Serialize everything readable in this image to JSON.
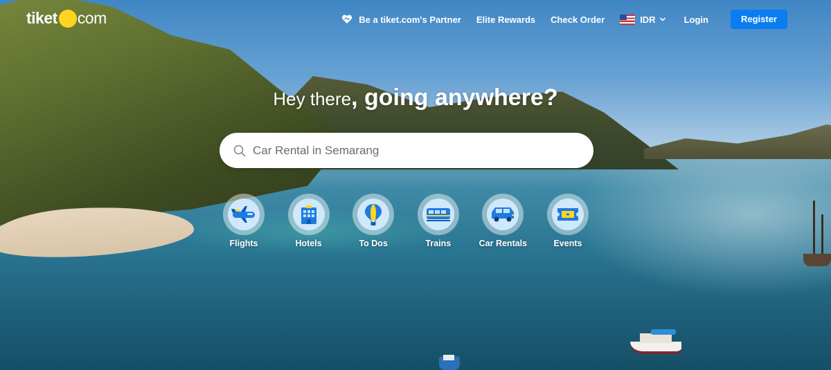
{
  "brand": {
    "logo_prefix": "tiket",
    "logo_suffix": "com",
    "logo_dot_color": "#ffd51f"
  },
  "nav": {
    "partner_label": "Be a tiket.com's Partner",
    "partner_icon": "handshake-heart-icon",
    "elite_rewards_label": "Elite Rewards",
    "check_order_label": "Check Order",
    "currency_label": "IDR",
    "currency_flag_icon": "us-flag-icon",
    "login_label": "Login",
    "register_label": "Register",
    "register_color": "#0a7df0"
  },
  "headline": {
    "light": "Hey there",
    "bold": ", going anywhere?"
  },
  "search": {
    "placeholder": "Car Rental in Semarang",
    "value": ""
  },
  "categories": [
    {
      "label": "Flights",
      "icon": "airplane-icon"
    },
    {
      "label": "Hotels",
      "icon": "hotel-building-icon"
    },
    {
      "label": "To Dos",
      "icon": "hot-air-balloon-icon"
    },
    {
      "label": "Trains",
      "icon": "train-icon"
    },
    {
      "label": "Car Rentals",
      "icon": "car-icon"
    },
    {
      "label": "Events",
      "icon": "ticket-icon"
    }
  ]
}
